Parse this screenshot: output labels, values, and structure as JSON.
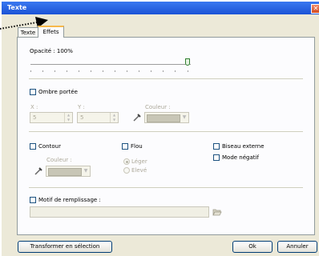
{
  "window": {
    "title": "Texte"
  },
  "tabs": [
    {
      "label": "Texte"
    },
    {
      "label": "Effets"
    }
  ],
  "opacity": {
    "label": "Opacité : 100%",
    "value_percent": 100
  },
  "shadow": {
    "checkbox_label": "Ombre portée",
    "x_label": "X :",
    "x_value": "5",
    "y_label": "Y :",
    "y_value": "5",
    "color_label": "Couleur :"
  },
  "contour": {
    "checkbox_label": "Contour",
    "color_label": "Couleur :"
  },
  "blur": {
    "checkbox_label": "Flou",
    "options": [
      "Léger",
      "Elevé"
    ],
    "selected": "Léger"
  },
  "bevel": {
    "checkbox_label": "Biseau externe"
  },
  "negative": {
    "checkbox_label": "Mode négatif"
  },
  "fill_pattern": {
    "checkbox_label": "Motif de remplissage :",
    "path_value": ""
  },
  "buttons": {
    "convert": "Transformer en sélection",
    "ok": "Ok",
    "cancel": "Annuler"
  }
}
